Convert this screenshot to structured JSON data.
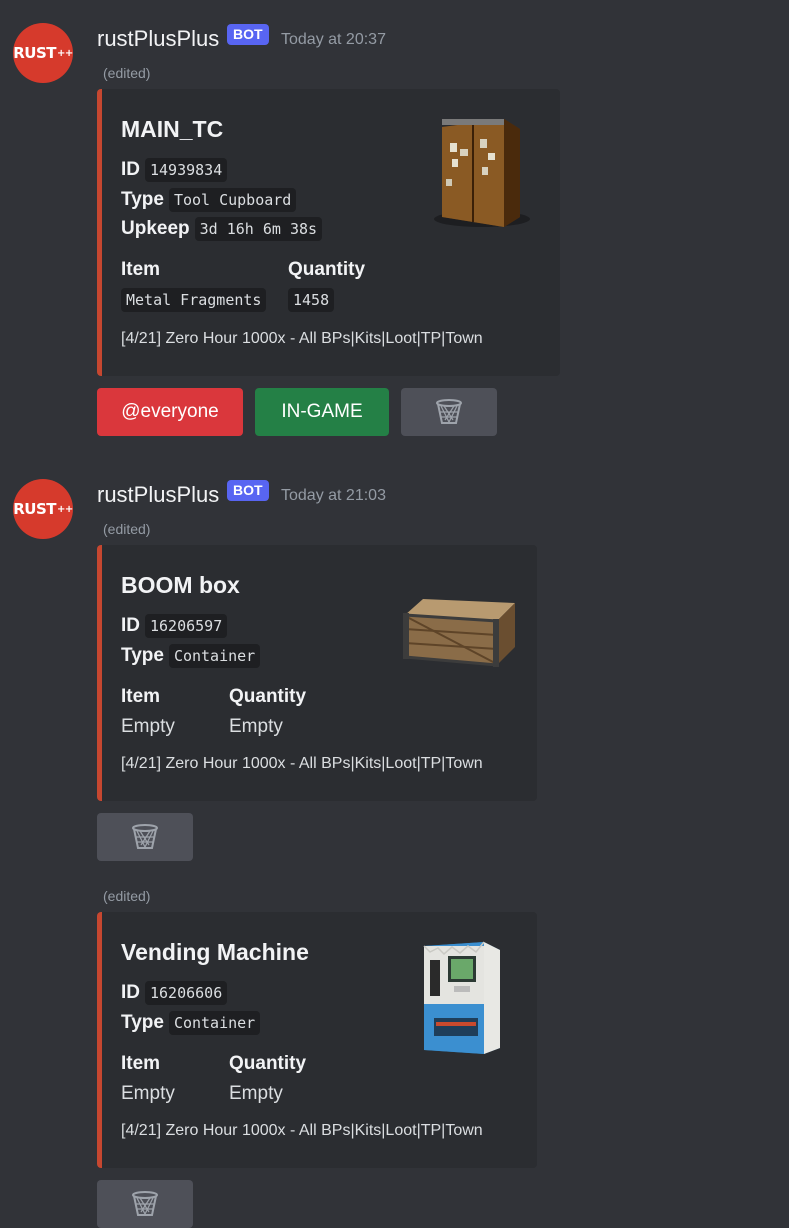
{
  "messages": [
    {
      "username": "rustPlusPlus",
      "bot_badge": "BOT",
      "timestamp": "Today at 20:37",
      "edited": "(edited)",
      "avatar_text": "RUST",
      "avatar_sup": "++",
      "embed": {
        "title": "MAIN_TC",
        "id_label": "ID",
        "id_value": "14939834",
        "type_label": "Type",
        "type_value": "Tool Cupboard",
        "upkeep_label": "Upkeep",
        "upkeep_value": "3d 16h 6m 38s",
        "item_header": "Item",
        "quantity_header": "Quantity",
        "item_value": "Metal Fragments",
        "quantity_value": "1458",
        "footer": "[4/21] Zero Hour 1000x - All BPs|Kits|Loot|TP|Town",
        "thumbnail": "tool-cupboard-image"
      },
      "buttons": [
        "@everyone",
        "IN-GAME"
      ],
      "trash_icon": "trash-basket-icon"
    },
    {
      "username": "rustPlusPlus",
      "bot_badge": "BOT",
      "timestamp": "Today at 21:03",
      "edited": "(edited)",
      "avatar_text": "RUST",
      "avatar_sup": "++",
      "embed": {
        "title": "BOOM box",
        "id_label": "ID",
        "id_value": "16206597",
        "type_label": "Type",
        "type_value": "Container",
        "item_header": "Item",
        "quantity_header": "Quantity",
        "item_value": "Empty",
        "quantity_value": "Empty",
        "footer": "[4/21] Zero Hour 1000x - All BPs|Kits|Loot|TP|Town",
        "thumbnail": "wooden-box-image"
      },
      "trash_icon": "trash-basket-icon"
    },
    {
      "edited": "(edited)",
      "embed": {
        "title": "Vending Machine",
        "id_label": "ID",
        "id_value": "16206606",
        "type_label": "Type",
        "type_value": "Container",
        "item_header": "Item",
        "quantity_header": "Quantity",
        "item_value": "Empty",
        "quantity_value": "Empty",
        "footer": "[4/21] Zero Hour 1000x - All BPs|Kits|Loot|TP|Town",
        "thumbnail": "vending-machine-image"
      },
      "trash_icon": "trash-basket-icon"
    }
  ]
}
